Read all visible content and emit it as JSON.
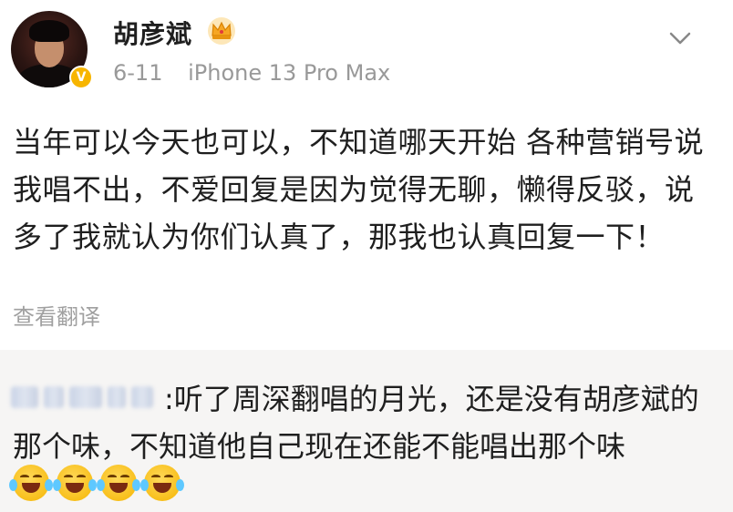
{
  "post": {
    "username": "胡彦斌",
    "date": "6-11",
    "device": "iPhone 13 Pro Max",
    "verified_badge": "V",
    "content": "当年可以今天也可以，不知道哪天开始 各种营销号说我唱不出，不爱回复是因为觉得无聊，懒得反驳，说多了我就认为你们认真了，那我也认真回复一下！",
    "translate_label": "查看翻译"
  },
  "comment": {
    "text": ":听了周深翻唱的月光，还是没有胡彦斌的那个味，不知道他自己现在还能不能唱出那个味",
    "emojis": [
      "laugh-cry-emoji",
      "laugh-cry-emoji",
      "laugh-cry-emoji",
      "laugh-cry-emoji"
    ]
  },
  "icons": {
    "crown": "crown-icon",
    "menu": "chevron-down-icon"
  },
  "colors": {
    "verified": "#f7b500",
    "meta_text": "#999999",
    "comment_bg": "#f6f5f4"
  }
}
